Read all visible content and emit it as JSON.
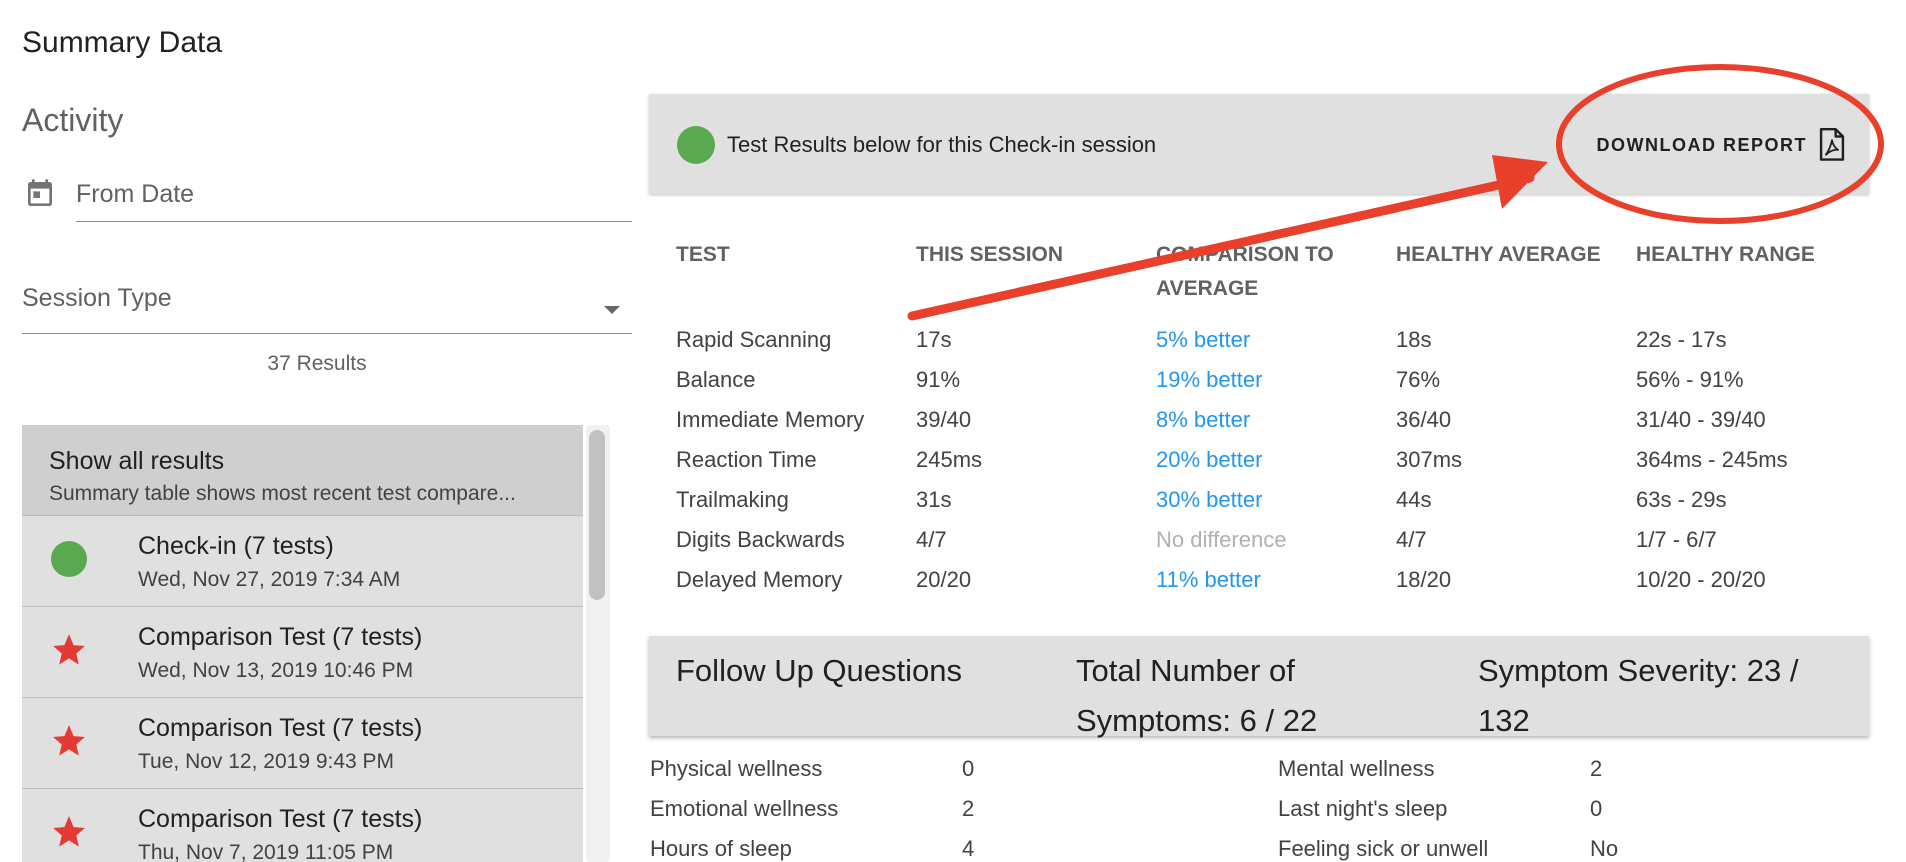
{
  "page": {
    "title": "Summary Data"
  },
  "activity": {
    "title": "Activity",
    "from_date_placeholder": "From Date",
    "session_type_label": "Session Type",
    "results_count": "37 Results"
  },
  "session_list": {
    "show_all": {
      "title": "Show all results",
      "subtitle": "Summary table shows most recent test compare..."
    },
    "items": [
      {
        "title": "Check-in (7 tests)",
        "date": "Wed, Nov 27, 2019 7:34 AM",
        "icon": "green-circle-icon"
      },
      {
        "title": "Comparison Test (7 tests)",
        "date": "Wed, Nov 13, 2019 10:46 PM",
        "icon": "star-icon"
      },
      {
        "title": "Comparison Test (7 tests)",
        "date": "Tue, Nov 12, 2019 9:43 PM",
        "icon": "star-icon"
      },
      {
        "title": "Comparison Test (7 tests)",
        "date": "Thu, Nov 7, 2019 11:05 PM",
        "icon": "star-icon"
      }
    ]
  },
  "results_header": {
    "text": "Test Results below for this Check-in session",
    "download_label": "DOWNLOAD REPORT"
  },
  "results_table": {
    "headers": [
      "TEST",
      "THIS SESSION",
      "COMPARISON TO AVERAGE",
      "HEALTHY AVERAGE",
      "HEALTHY RANGE"
    ],
    "rows": [
      [
        "Rapid Scanning",
        "17s",
        "5% better",
        "18s",
        "22s - 17s"
      ],
      [
        "Balance",
        "91%",
        "19% better",
        "76%",
        "56% - 91%"
      ],
      [
        "Immediate Memory",
        "39/40",
        "8% better",
        "36/40",
        "31/40 - 39/40"
      ],
      [
        "Reaction Time",
        "245ms",
        "20% better",
        "307ms",
        "364ms - 245ms"
      ],
      [
        "Trailmaking",
        "31s",
        "30% better",
        "44s",
        "63s - 29s"
      ],
      [
        "Digits Backwards",
        "4/7",
        "No difference",
        "4/7",
        "1/7 - 6/7"
      ],
      [
        "Delayed Memory",
        "20/20",
        "11% better",
        "18/20",
        "10/20 - 20/20"
      ]
    ]
  },
  "follow_up": {
    "title": "Follow Up Questions",
    "total_symptoms": "Total Number of Symptoms: 6 / 22",
    "severity": "Symptom Severity: 23 / 132",
    "rows": [
      {
        "k1": "Physical wellness",
        "v1": "0",
        "k2": "Mental wellness",
        "v2": "2"
      },
      {
        "k1": "Emotional wellness",
        "v1": "2",
        "k2": "Last night's sleep",
        "v2": "0"
      },
      {
        "k1": "Hours of sleep",
        "v1": "4",
        "k2": "Feeling sick or unwell",
        "v2": "No"
      }
    ]
  },
  "colors": {
    "accent_blue": "#2196f3",
    "status_green": "#5aa84f",
    "star_red": "#e53935",
    "annotation_red": "#e8402a",
    "panel_gray": "#e0e0e0"
  }
}
